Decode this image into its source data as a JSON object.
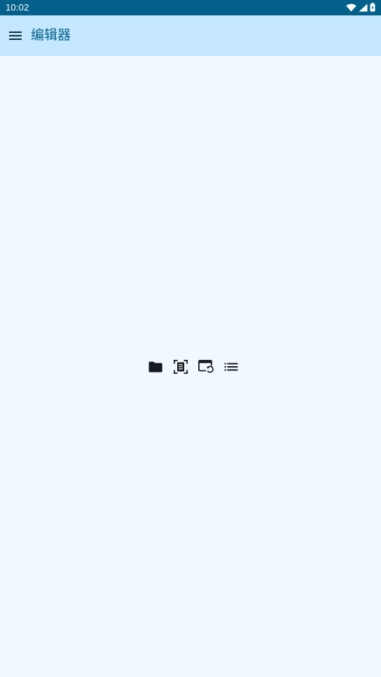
{
  "status_bar": {
    "time": "10:02",
    "icons": [
      "wifi-icon",
      "cellular-signal-icon",
      "battery-charging-icon"
    ]
  },
  "app_bar": {
    "menu_icon": "hamburger-menu-icon",
    "title": "编辑器"
  },
  "toolbar": {
    "items": [
      {
        "icon": "folder-icon"
      },
      {
        "icon": "document-scan-icon"
      },
      {
        "icon": "window-restore-icon"
      },
      {
        "icon": "list-icon"
      }
    ]
  },
  "colors": {
    "status_bar_bg": "#02608a",
    "app_bar_bg": "#c5e7ff",
    "title_color": "#03618a",
    "page_bg": "#f1f8fe",
    "icon_color": "#16191d"
  }
}
